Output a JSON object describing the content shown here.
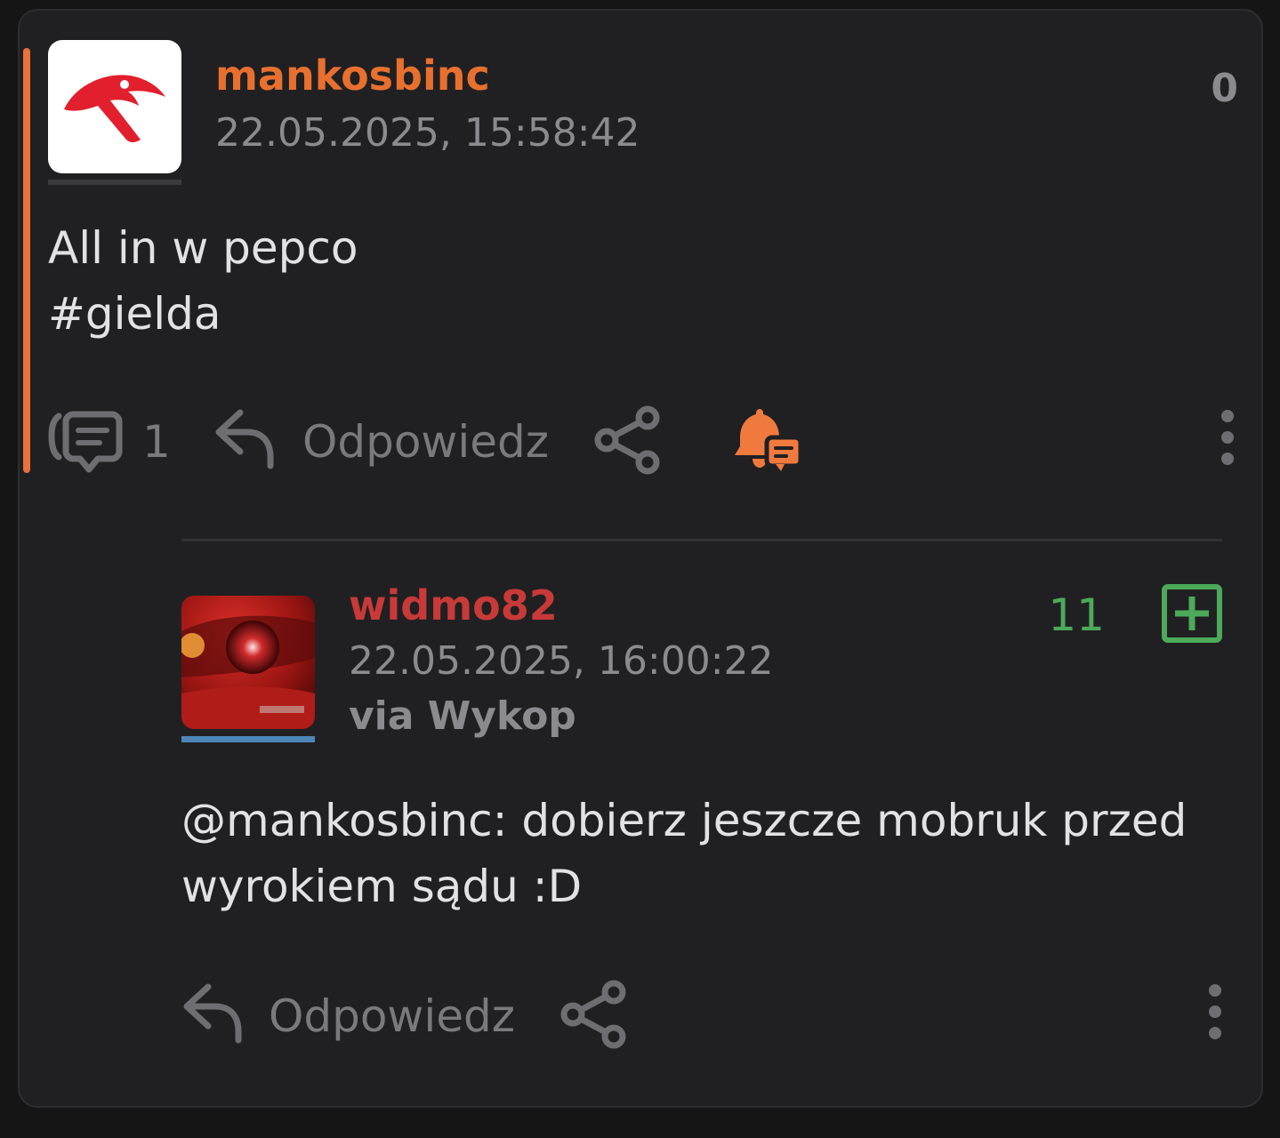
{
  "post": {
    "author": "mankosbinc",
    "timestamp": "22.05.2025, 15:58:42",
    "score": "0",
    "body_lines": [
      "All in w pepco",
      "#gielda"
    ],
    "comments_count": "1",
    "reply_label": "Odpowiedz",
    "icons": [
      "comments-icon",
      "reply-icon",
      "share-icon",
      "notification-bell-icon",
      "more-options-icon"
    ],
    "colors": {
      "author": "#e8702f",
      "accent_bar": "#e8723a",
      "bell": "#f07a3e"
    }
  },
  "comment": {
    "author": "widmo82",
    "timestamp": "22.05.2025, 16:00:22",
    "source": "via Wykop",
    "score": "11",
    "body_lines": [
      "@mankosbinc: dobierz jeszcze mobruk przed",
      "wyrokiem sądu :D"
    ],
    "reply_label": "Odpowiedz",
    "icons": [
      "upvote-plus-icon",
      "reply-icon",
      "share-icon",
      "more-options-icon"
    ],
    "colors": {
      "author": "#c83a38",
      "score": "#4caa5a",
      "avatar_underline": "#4d86b7"
    }
  }
}
